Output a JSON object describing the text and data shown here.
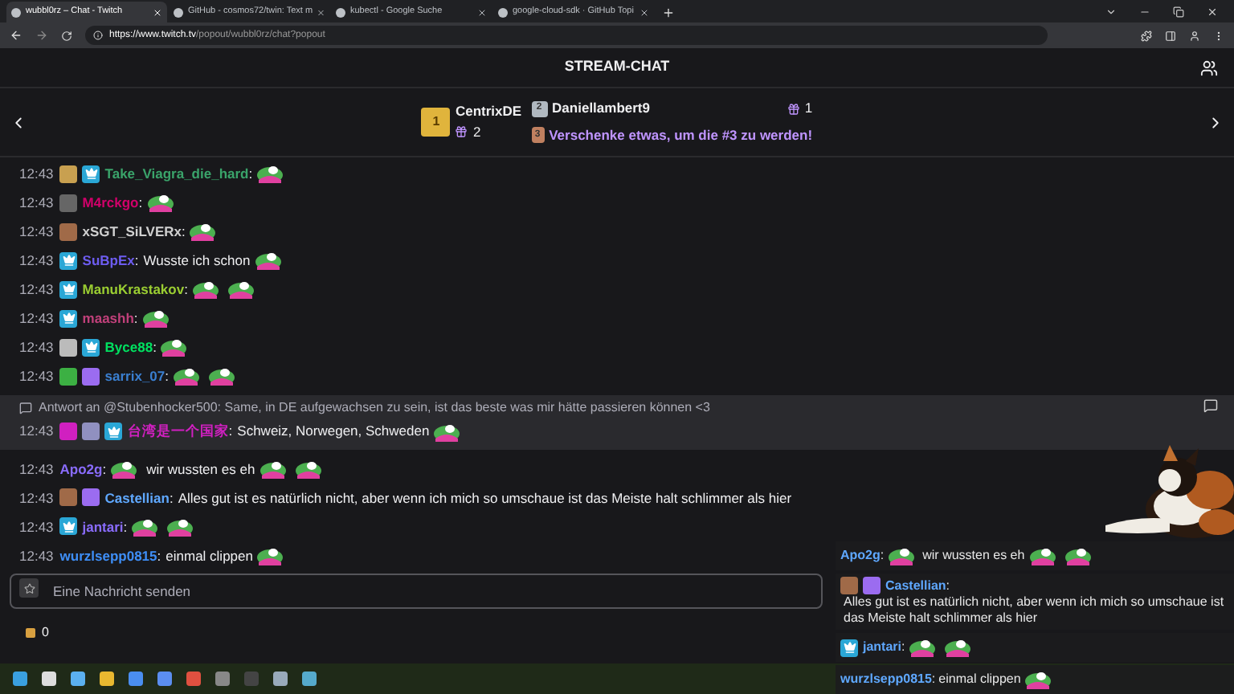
{
  "browser": {
    "tabs": [
      {
        "title": "wubbl0rz – Chat - Twitch",
        "selected": true
      },
      {
        "title": "GitHub - cosmos72/twin: Text m",
        "selected": false
      },
      {
        "title": "kubectl - Google Suche",
        "selected": false
      },
      {
        "title": "google-cloud-sdk · GitHub Topi",
        "selected": false
      }
    ],
    "url_host": "https://www.twitch.tv",
    "url_path": "/popout/wubbl0rz/chat?popout"
  },
  "chat": {
    "title": "STREAM-CHAT",
    "leaderboard": {
      "first": {
        "rank": "1",
        "name": "CentrixDE",
        "gifts": "2"
      },
      "second": {
        "rank": "2",
        "name": "Daniellambert9",
        "gifts": "1"
      },
      "third": {
        "rank": "3",
        "text": "Verschenke etwas, um die #3 zu werden!"
      }
    },
    "messages": [
      {
        "time": "12:43",
        "badges": [
          {
            "kind": "tile",
            "color": "#c8a050"
          },
          {
            "kind": "crown",
            "color": "#2aa7d6"
          }
        ],
        "user": "Take_Viagra_die_hard",
        "sep": ":",
        "color": "#3aa36a",
        "parts": [
          {
            "kind": "emote"
          }
        ]
      },
      {
        "time": "12:43",
        "badges": [
          {
            "kind": "tile",
            "color": "#666666"
          }
        ],
        "user": "M4rckgo",
        "sep": ":",
        "color": "#d1006a",
        "parts": [
          {
            "kind": "emote"
          }
        ]
      },
      {
        "time": "12:43",
        "badges": [
          {
            "kind": "tile",
            "color": "#a06a48"
          }
        ],
        "user": "xSGT_SiLVERx",
        "sep": ":",
        "color": "#d0d0d0",
        "parts": [
          {
            "kind": "emote"
          }
        ]
      },
      {
        "time": "12:43",
        "badges": [
          {
            "kind": "crown",
            "color": "#2aa7d6"
          }
        ],
        "user": "SuBpEx",
        "sep": ":",
        "color": "#6d5cf0",
        "parts": [
          {
            "kind": "text",
            "text": "Wusste ich schon"
          },
          {
            "kind": "emote"
          }
        ]
      },
      {
        "time": "12:43",
        "badges": [
          {
            "kind": "crown",
            "color": "#2aa7d6"
          }
        ],
        "user": "ManuKrastakov",
        "sep": ":",
        "color": "#9acd32",
        "parts": [
          {
            "kind": "emote"
          },
          {
            "kind": "emote"
          }
        ]
      },
      {
        "time": "12:43",
        "badges": [
          {
            "kind": "crown",
            "color": "#2aa7d6"
          }
        ],
        "user": "maashh",
        "sep": ":",
        "color": "#c0407a",
        "parts": [
          {
            "kind": "emote"
          }
        ]
      },
      {
        "time": "12:43",
        "badges": [
          {
            "kind": "tile",
            "color": "#bbbbbb"
          },
          {
            "kind": "crown",
            "color": "#2aa7d6"
          }
        ],
        "user": "Byce88",
        "sep": ":",
        "color": "#00e060",
        "parts": [
          {
            "kind": "emote"
          }
        ]
      },
      {
        "time": "12:43",
        "badges": [
          {
            "kind": "tile",
            "color": "#3cb043"
          },
          {
            "kind": "tile",
            "color": "#9b6cf0"
          }
        ],
        "user": "sarrix_07",
        "sep": ":",
        "color": "#3a7fd0",
        "parts": [
          {
            "kind": "emote"
          },
          {
            "kind": "emote"
          }
        ]
      },
      {
        "time": "12:43",
        "reply": "Antwort an @Stubenhocker500: Same, in DE aufgewachsen zu sein, ist das beste was mir hätte passieren können <3",
        "badges": [
          {
            "kind": "tile",
            "color": "#d020c0"
          },
          {
            "kind": "tile",
            "color": "#9090c0"
          },
          {
            "kind": "crown",
            "color": "#2aa7d6"
          }
        ],
        "user": "台湾是一个国家",
        "sep": ":",
        "color": "#d020c0",
        "parts": [
          {
            "kind": "text",
            "text": "Schweiz, Norwegen, Schweden"
          },
          {
            "kind": "emote"
          }
        ]
      },
      {
        "time": "12:43",
        "user": "Apo2g",
        "sep": ":",
        "color": "#8a6cff",
        "parts": [
          {
            "kind": "emote"
          },
          {
            "kind": "text",
            "text": "wir wussten es eh"
          },
          {
            "kind": "emote"
          },
          {
            "kind": "emote"
          }
        ]
      },
      {
        "time": "12:43",
        "badges": [
          {
            "kind": "tile",
            "color": "#a06a48"
          },
          {
            "kind": "tile",
            "color": "#9b6cf0"
          }
        ],
        "user": "Castellian",
        "sep": ":",
        "color": "#5fa8ff",
        "parts": [
          {
            "kind": "text",
            "text": "Alles gut ist es natürlich nicht, aber wenn ich mich so umschaue ist das Meiste halt schlimmer als hier"
          }
        ]
      },
      {
        "time": "12:43",
        "badges": [
          {
            "kind": "crown",
            "color": "#2aa7d6"
          }
        ],
        "user": "jantari",
        "sep": ":",
        "color": "#8a6cff",
        "parts": [
          {
            "kind": "emote"
          },
          {
            "kind": "emote"
          }
        ]
      },
      {
        "time": "12:43",
        "user": "wurzlsepp0815",
        "sep": ":",
        "color": "#3e8ef7",
        "parts": [
          {
            "kind": "text",
            "text": "einmal clippen"
          },
          {
            "kind": "emote"
          }
        ]
      }
    ],
    "input": {
      "placeholder": "Eine Nachricht senden"
    },
    "points": "0"
  },
  "overlay": {
    "messages": [
      {
        "user": "Apo2g",
        "sep": ":",
        "color": "#5fa8ff",
        "parts": [
          {
            "kind": "emote"
          },
          {
            "kind": "text",
            "text": "wir wussten es eh"
          },
          {
            "kind": "emote"
          },
          {
            "kind": "emote"
          }
        ]
      },
      {
        "badges": [
          {
            "kind": "tile",
            "color": "#a06a48"
          },
          {
            "kind": "tile",
            "color": "#9b6cf0"
          }
        ],
        "user": "Castellian",
        "sep": ":",
        "color": "#5fa8ff",
        "parts": [
          {
            "kind": "text",
            "text": "Alles gut ist es natürlich nicht, aber wenn ich mich so umschaue ist das Meiste halt schlimmer als hier"
          }
        ]
      },
      {
        "badges": [
          {
            "kind": "crown",
            "color": "#2aa7d6"
          }
        ],
        "user": "jantari",
        "sep": ":",
        "color": "#5fa8ff",
        "parts": [
          {
            "kind": "emote"
          },
          {
            "kind": "emote"
          }
        ]
      },
      {
        "user": "wurzlsepp0815",
        "sep": ":",
        "color": "#5fa8ff",
        "parts": [
          {
            "kind": "text",
            "text": "einmal clippen"
          },
          {
            "kind": "emote"
          }
        ]
      }
    ]
  }
}
